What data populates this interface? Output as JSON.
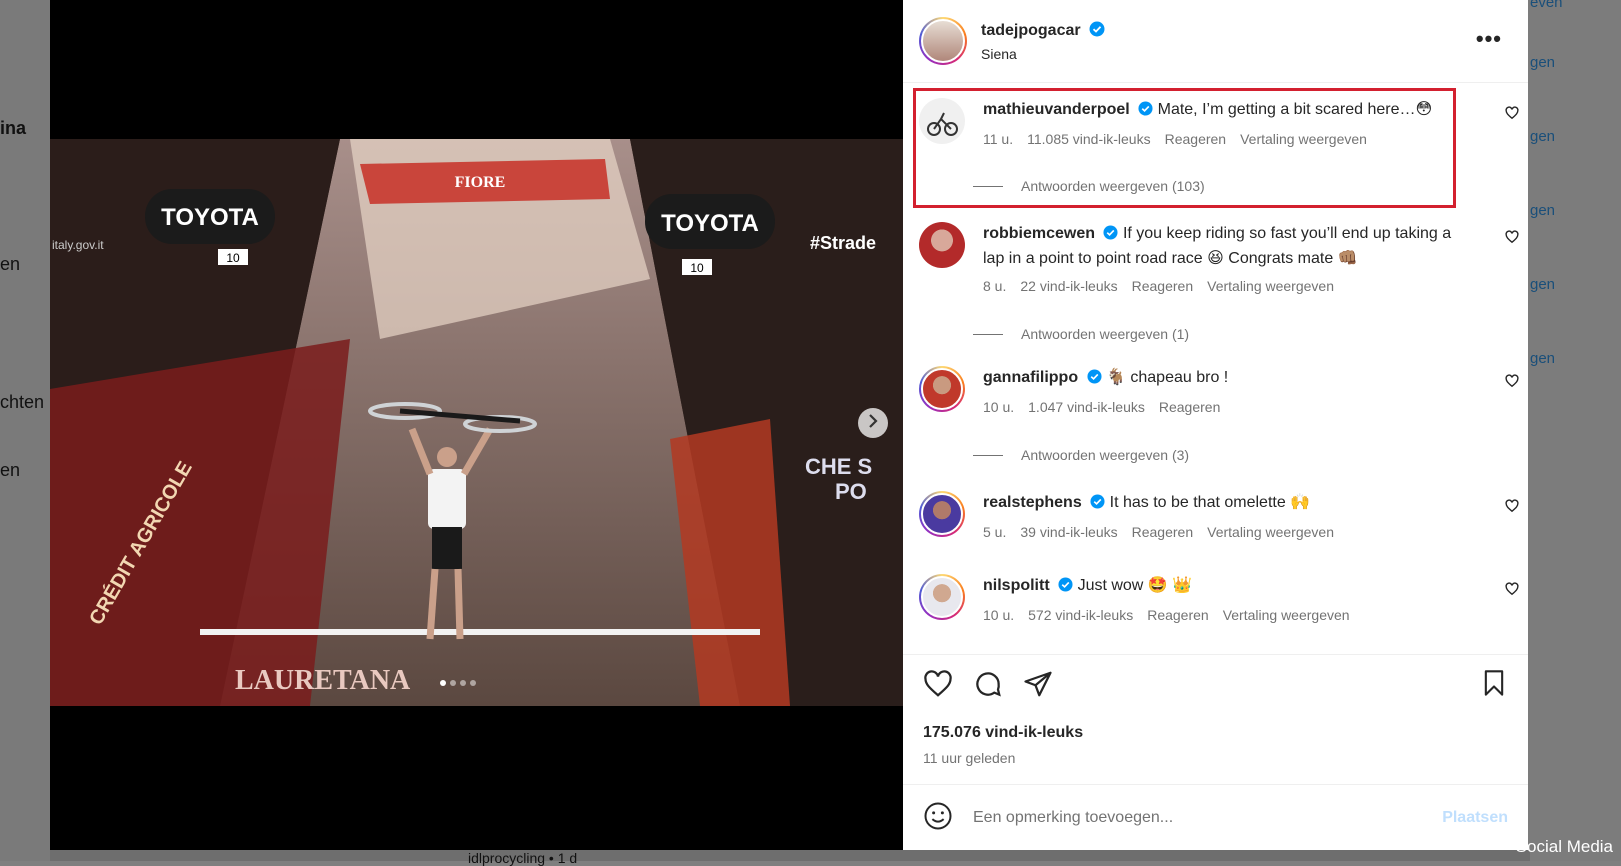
{
  "background": {
    "left_fragments": [
      "ina",
      "en",
      "chten",
      "en"
    ],
    "right_fragments": [
      "even",
      "gen",
      "gen",
      "gen",
      "gen",
      "gen"
    ],
    "bottom_fragment": "idlprocycling • 1 d"
  },
  "watermark": "Social Media",
  "post": {
    "author": "tadejpogacar",
    "location": "Siena",
    "likes": "175.076 vind-ik-leuks",
    "time": "11 uur geleden",
    "image_text": [
      "TOYOTA",
      "FIORE",
      "TOYOTA",
      "10",
      "10",
      "#Strade",
      "CHE S",
      "PO",
      "LAURETANA",
      "CRÉDIT AGRICOLE",
      "italy.gov.it"
    ]
  },
  "comments": [
    {
      "user": "mathieuvanderpoel",
      "text": "Mate, I’m getting a bit scared here…😳",
      "time": "11 u.",
      "likes": "11.085 vind-ik-leuks",
      "reply": "Reageren",
      "translate": "Vertaling weergeven",
      "replies": "Antwoorden weergeven (103)"
    },
    {
      "user": "robbiemcewen",
      "text": "If you keep riding so fast you’ll end up taking a lap in a point to point road race 😆 Congrats mate 👊🏽",
      "time": "8 u.",
      "likes": "22 vind-ik-leuks",
      "reply": "Reageren",
      "translate": "Vertaling weergeven",
      "replies": "Antwoorden weergeven (1)"
    },
    {
      "user": "gannafilippo",
      "text": "🐐 chapeau bro !",
      "time": "10 u.",
      "likes": "1.047 vind-ik-leuks",
      "reply": "Reageren",
      "replies": "Antwoorden weergeven (3)"
    },
    {
      "user": "realstephens",
      "text": "It has to be that omelette 🙌",
      "time": "5 u.",
      "likes": "39 vind-ik-leuks",
      "reply": "Reageren",
      "translate": "Vertaling weergeven"
    },
    {
      "user": "nilspolitt",
      "text": "Just wow 🤩 👑",
      "time": "10 u.",
      "likes": "572 vind-ik-leuks",
      "reply": "Reageren",
      "translate": "Vertaling weergeven"
    }
  ],
  "composer": {
    "placeholder": "Een opmerking toevoegen...",
    "post_label": "Plaatsen"
  },
  "colors": {
    "verified": "#0095f6",
    "highlight": "#d3202f",
    "link": "#0095f6",
    "muted": "#737373"
  },
  "icons": [
    "more-icon",
    "heart-icon",
    "comment-icon",
    "share-icon",
    "bookmark-icon",
    "emoji-icon",
    "verified-icon",
    "chevron-right-icon"
  ]
}
